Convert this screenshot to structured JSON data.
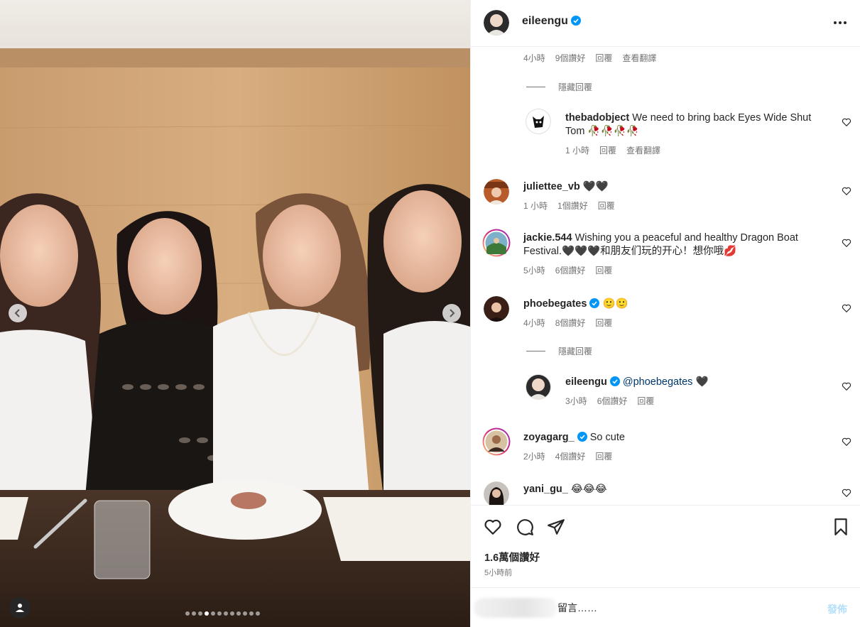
{
  "post": {
    "username": "eileengu",
    "likes": "1.6萬個讚好",
    "time_ago": "5小時前",
    "comment_placeholder": "留言……",
    "post_label": "發佈"
  },
  "carousel": {
    "slides": 12,
    "active_index": 3
  },
  "comments": [
    {
      "meta": [
        "4小時",
        "9個讚好",
        "回覆",
        "查看翻譯"
      ]
    },
    {
      "hide_replies": "隱藏回覆"
    },
    {
      "user": "thebadobject",
      "text": "We need to bring back Eyes Wide Shut Tom 🥀🥀🥀🥀",
      "time": "1 小時",
      "reply": "回覆",
      "translate": "查看翻譯"
    },
    {
      "user": "juliettee_vb",
      "text": "🖤🖤",
      "time": "1 小時",
      "likes": "1個讚好",
      "reply": "回覆"
    },
    {
      "user": "jackie.544",
      "text": "Wishing you a peaceful and healthy Dragon Boat Festival.🖤🖤🖤和朋友们玩的开心！想你哦💋",
      "time": "5小時",
      "likes": "6個讚好",
      "reply": "回覆"
    },
    {
      "user": "phoebegates",
      "text": "🙂🙂",
      "time": "4小時",
      "likes": "8個讚好",
      "reply": "回覆"
    },
    {
      "hide_replies": "隱藏回覆"
    },
    {
      "user": "eileengu",
      "mention": "@phoebegates",
      "text": "🖤",
      "time": "3小時",
      "likes": "6個讚好",
      "reply": "回覆"
    },
    {
      "user": "zoyagarg_",
      "text": "So cute",
      "time": "2小時",
      "likes": "4個讚好",
      "reply": "回覆"
    },
    {
      "user": "yani_gu_",
      "text": "😂😂😂",
      "time": "",
      "likes": "",
      "reply": ""
    }
  ],
  "icons": {
    "like": "heart-icon",
    "comment": "comment-icon",
    "share": "paper-plane-icon",
    "save": "bookmark-icon",
    "more": "more-options-icon"
  },
  "colors": {
    "verified": "#0095f6",
    "mention": "#00376b",
    "post_button_disabled": "#b2dffc"
  }
}
